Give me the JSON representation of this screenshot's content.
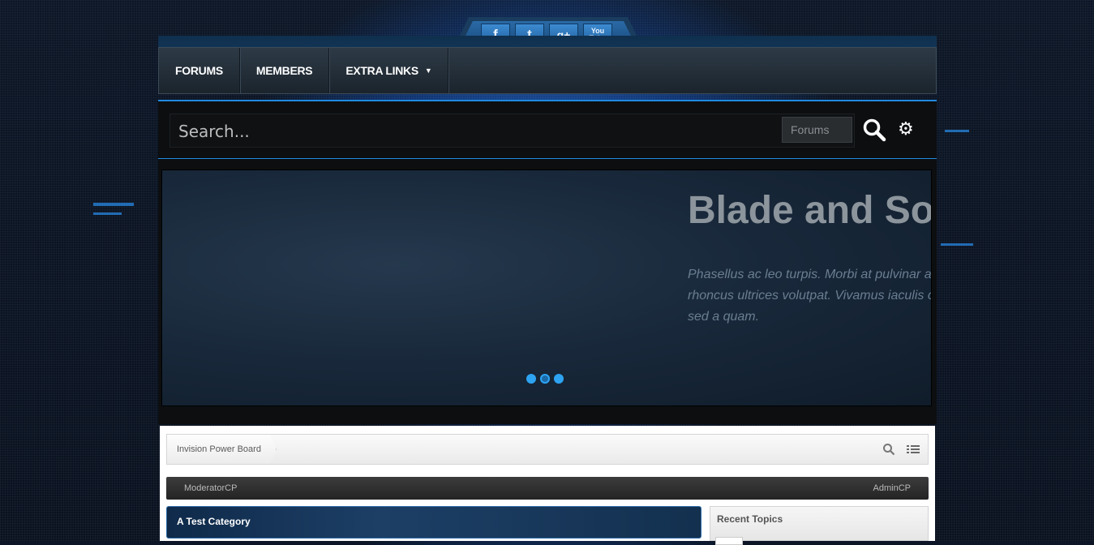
{
  "social": {
    "facebook": "f",
    "twitter": "t",
    "googleplus": "g+",
    "youtube": "You Tube",
    "icons": [
      "facebook-icon",
      "twitter-icon",
      "googleplus-icon",
      "youtube-icon"
    ]
  },
  "nav": {
    "items": [
      {
        "label": "FORUMS"
      },
      {
        "label": "MEMBERS"
      },
      {
        "label": "EXTRA LINKS"
      }
    ]
  },
  "search": {
    "placeholder": "Search...",
    "scope": "Forums"
  },
  "slider": {
    "title": "Blade and So",
    "text": "Phasellus ac leo turpis. Morbi at pulvinar a Aenean rhoncus ultrices volutpat. Vivamus iaculis condimentum sed a quam."
  },
  "breadcrumb": {
    "root": "Invision Power Board"
  },
  "modbar": {
    "left": "ModeratorCP",
    "right": "AdminCP"
  },
  "category": {
    "title": "A Test Category"
  },
  "sidebar": {
    "recent_title": "Recent Topics"
  },
  "colors": {
    "accent": "#2ea3f2",
    "nav_bg": "#2d3a46"
  }
}
